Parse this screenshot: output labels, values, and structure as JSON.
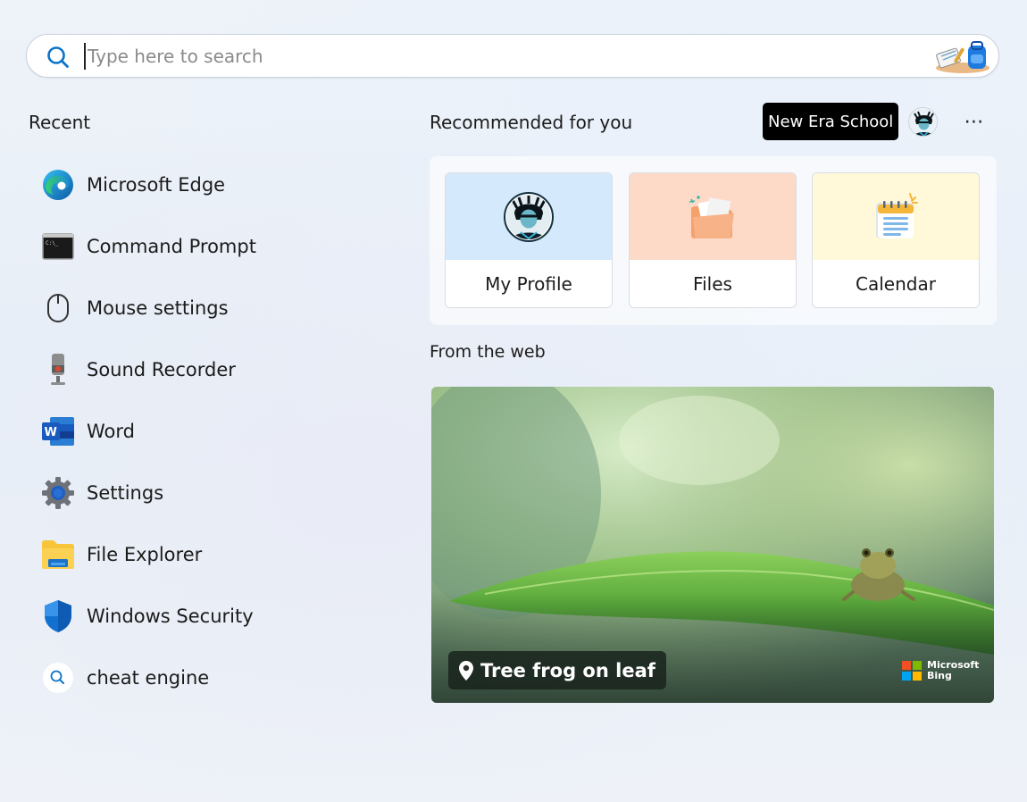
{
  "search": {
    "placeholder": "Type here to search",
    "value": ""
  },
  "recent": {
    "heading": "Recent",
    "items": [
      {
        "label": "Microsoft Edge",
        "icon": "edge-icon"
      },
      {
        "label": "Command Prompt",
        "icon": "command-prompt-icon"
      },
      {
        "label": "Mouse settings",
        "icon": "mouse-icon"
      },
      {
        "label": "Sound Recorder",
        "icon": "microphone-icon"
      },
      {
        "label": "Word",
        "icon": "word-icon"
      },
      {
        "label": "Settings",
        "icon": "gear-icon"
      },
      {
        "label": "File Explorer",
        "icon": "folder-icon"
      },
      {
        "label": "Windows Security",
        "icon": "shield-icon"
      },
      {
        "label": "cheat engine",
        "icon": "search-icon"
      }
    ]
  },
  "recommended": {
    "heading": "Recommended for you",
    "org_badge": "New Era School",
    "more_label": "⋯",
    "cards": [
      {
        "label": "My Profile",
        "icon": "avatar"
      },
      {
        "label": "Files",
        "icon": "folder-icon"
      },
      {
        "label": "Calendar",
        "icon": "calendar-icon"
      }
    ]
  },
  "web": {
    "heading": "From the web",
    "caption": "Tree frog on leaf",
    "bing_line1": "Microsoft",
    "bing_line2": "Bing"
  },
  "colors": {
    "accent": "#0078d4",
    "badge_bg": "#000000",
    "profile_tile": "#d4e9fb",
    "files_tile": "#fdd9c8",
    "calendar_tile": "#fff9d9"
  }
}
